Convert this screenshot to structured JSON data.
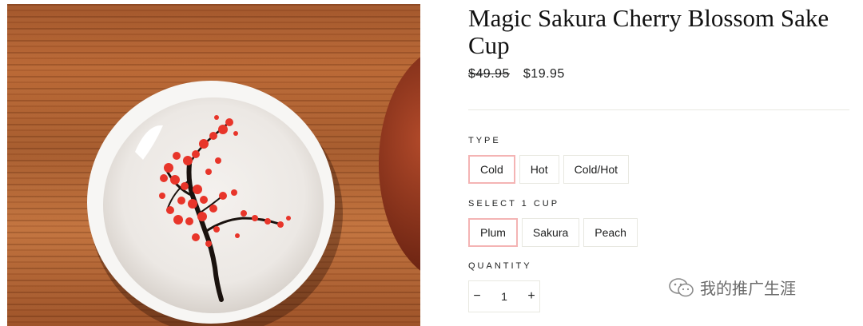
{
  "product": {
    "title": "Magic Sakura Cherry Blossom Sake Cup",
    "price_original": "$49.95",
    "price_sale": "$19.95"
  },
  "options": {
    "type_label": "TYPE",
    "type_values": [
      "Cold",
      "Hot",
      "Cold/Hot"
    ],
    "type_selected": "Cold",
    "cup_label": "SELECT 1 CUP",
    "cup_values": [
      "Plum",
      "Sakura",
      "Peach"
    ],
    "cup_selected": "Plum"
  },
  "quantity": {
    "label": "QUANTITY",
    "minus": "−",
    "value": "1",
    "plus": "+"
  },
  "watermark": {
    "text": "我的推广生涯",
    "icon": "wechat-icon"
  },
  "colors": {
    "selected_border": "#f4b4b4",
    "blossom": "#e8352a"
  }
}
